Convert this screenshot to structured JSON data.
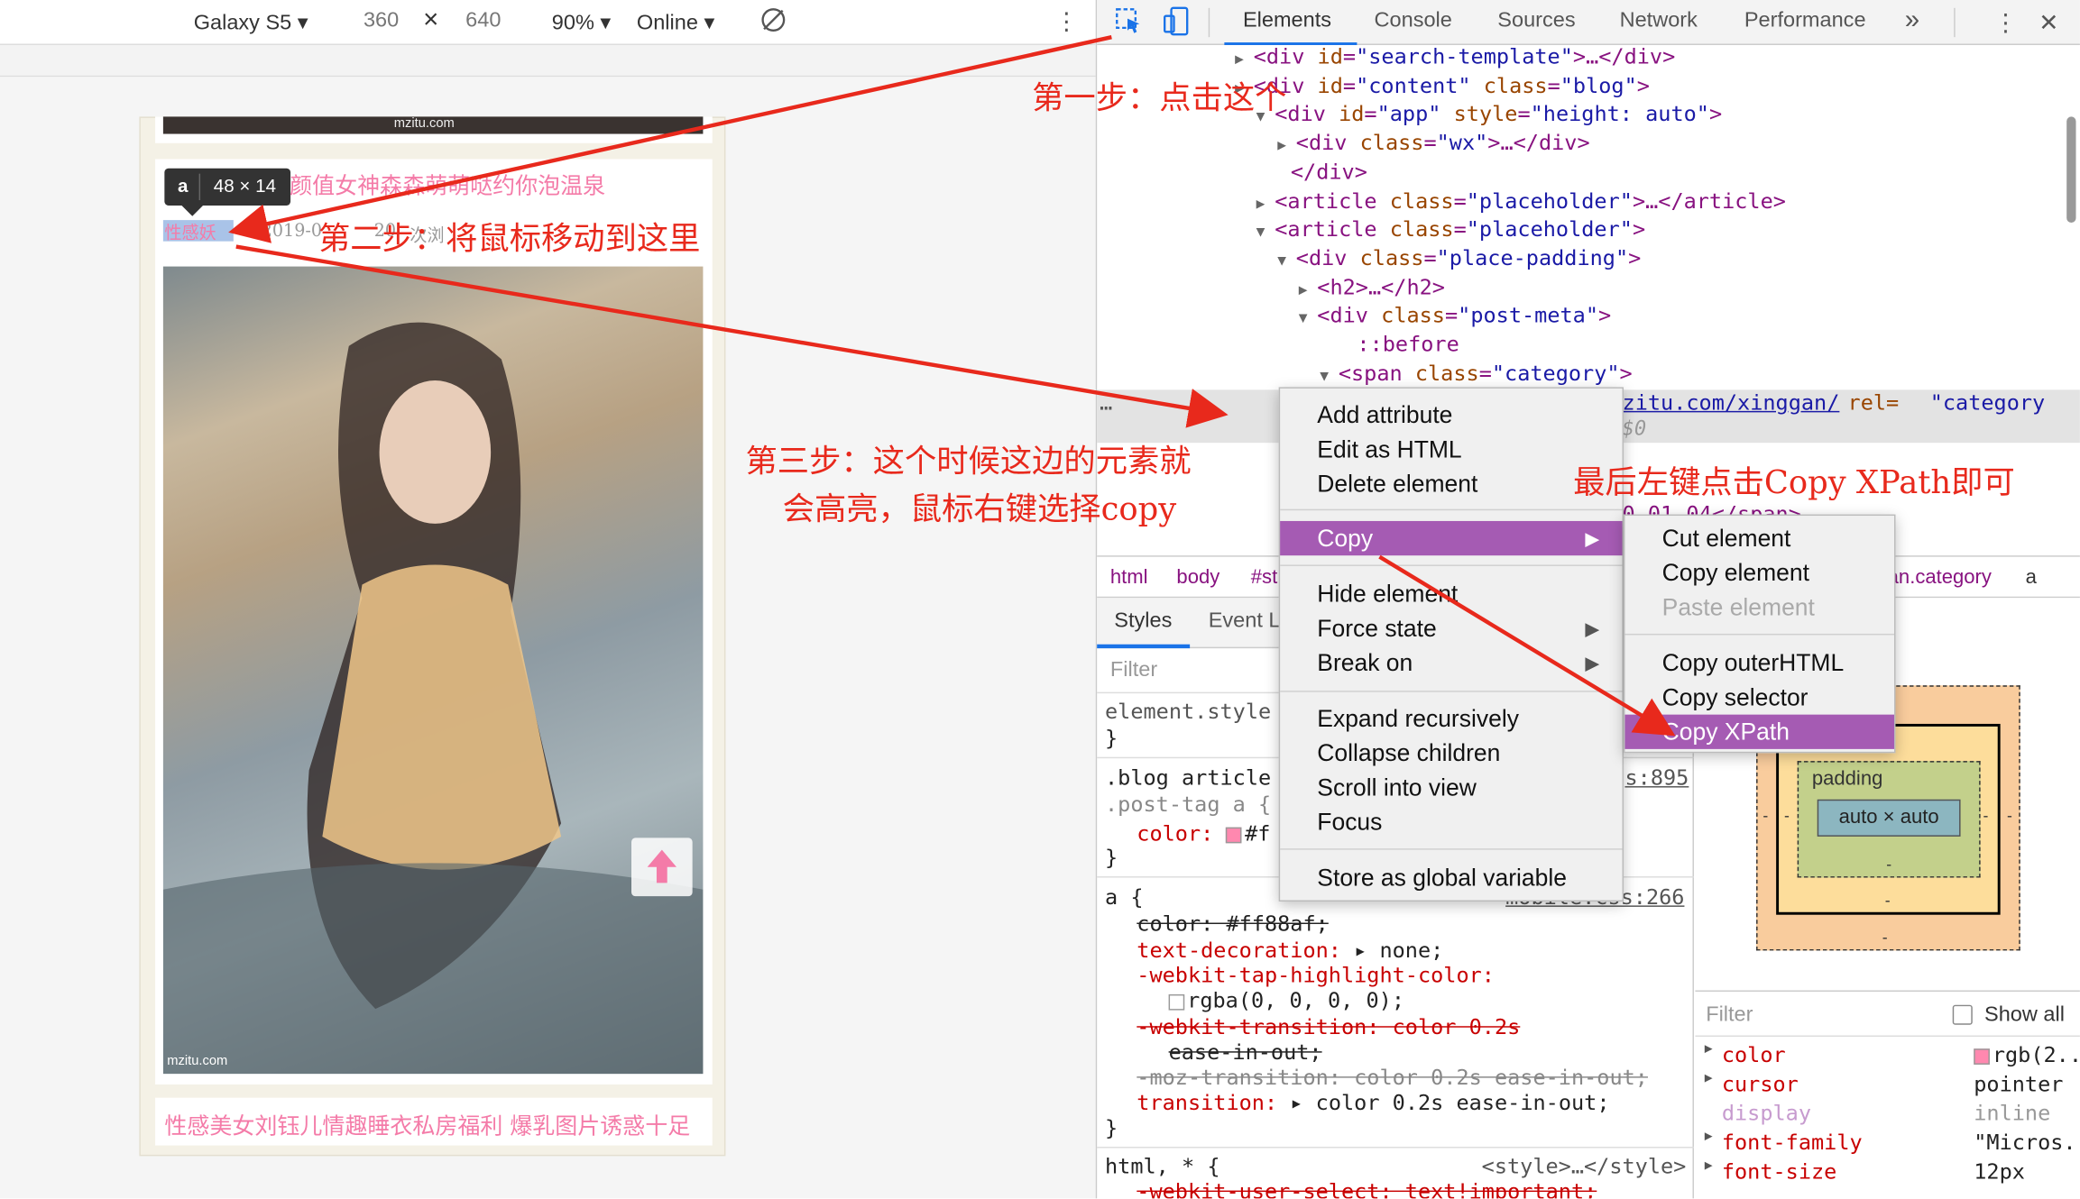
{
  "device_toolbar": {
    "device": "Galaxy S5",
    "width": "360",
    "times": "×",
    "height": "640",
    "zoom": "90%",
    "network": "Online"
  },
  "page": {
    "watermark": "mzitu.com",
    "post_title": "性感 颜值女神森森萌萌哒约你泡温泉",
    "post_category": "性感妖",
    "post_date": "2019-0",
    "post_extra": "20",
    "views": "次浏",
    "tooltip_tag": "a",
    "tooltip_size": "48 × 14",
    "photo_watermark": "mzitu.com",
    "next_title": "性感美女刘钰儿情趣睡衣私房福利 爆乳图片诱惑十足"
  },
  "devtools": {
    "tabs": [
      "Elements",
      "Console",
      "Sources",
      "Network",
      "Performance"
    ],
    "more": "»",
    "dom_lines": [
      {
        "pre": "▶",
        "html": "<div id=\"search-template\">…</div>"
      },
      {
        "pre": "▶",
        "html": "<div id=\"content\" class=\"blog\">"
      },
      {
        "pre": "▼",
        "html": "<div id=\"app\" style=\"height: auto\">"
      },
      {
        "pre": "▶",
        "html": "<div class=\"wx\">…</div>"
      },
      {
        "pre": "",
        "html": "</div>"
      },
      {
        "pre": "▶",
        "html": "<article class=\"placeholder\">…</article>"
      },
      {
        "pre": "▼",
        "html": "<article class=\"placeholder\">"
      },
      {
        "pre": "▼",
        "html": "<div class=\"place-padding\">"
      },
      {
        "pre": "▶",
        "html": "<h2>…</h2>"
      },
      {
        "pre": "▼",
        "html": "<div class=\"post-meta\">"
      },
      {
        "pre": "",
        "html": "::before"
      },
      {
        "pre": "▼",
        "html": "<span class=\"category\">"
      }
    ],
    "selected_line": {
      "ellipsis": "…",
      "link": "zitu.com/xinggan/",
      "attr": " rel=",
      "value": "\"category",
      "hint": "$0"
    },
    "partial_line": "0 01 04</span>",
    "breadcrumbs": [
      "html",
      "body",
      "#st",
      "an.category",
      "a"
    ],
    "style_tabs": [
      "Styles",
      "Event L"
    ],
    "filter_placeholder": "Filter",
    "styles": {
      "element_style": "element.style {",
      "close1": "}",
      "rule1_sel1": ".blog article",
      "rule1_sel2": ".post-tag a {",
      "rule1_src": "s:895",
      "rule1_prop": "color:",
      "rule1_val": "#f",
      "close2": "}",
      "rule2_sel": "a {",
      "rule2_src": "mobile.css:266",
      "r2_color": "color: #ff88af;",
      "r2_td_prop": "text-decoration:",
      "r2_td_val": "none;",
      "r2_tap_prop": "-webkit-tap-highlight-color:",
      "r2_tap_val": "rgba(0, 0, 0, 0);",
      "r2_wt": "-webkit-transition: color 0.2s",
      "r2_ease1": "ease-in-out;",
      "r2_moz": "-moz-transition: color 0.2s ease-in-out;",
      "r2_tr_prop": "transition:",
      "r2_tr_val": "color 0.2s",
      "r2_ease2": "ease-in-out;",
      "close3": "}",
      "rule3_sel": "html, * {",
      "rule3_src": "<style>…</style>",
      "r3_line": "-webkit-user-select: text!important;"
    },
    "boxmodel": {
      "padding": "padding",
      "content": "auto × auto",
      "dash": "-"
    },
    "computed": {
      "filter_placeholder": "Filter",
      "show_all": "Show all",
      "rows": [
        {
          "name": "color",
          "value": "rgb(2..."
        },
        {
          "name": "cursor",
          "value": "pointer"
        },
        {
          "name": "display",
          "value": "inline"
        },
        {
          "name": "font-family",
          "value": "\"Micros..."
        },
        {
          "name": "font-size",
          "value": "12px"
        }
      ]
    }
  },
  "context_menu": {
    "items": [
      "Add attribute",
      "Edit as HTML",
      "Delete element",
      "Copy",
      "Hide element",
      "Force state",
      "Break on",
      "Expand recursively",
      "Collapse children",
      "Scroll into view",
      "Focus",
      "Store as global variable"
    ],
    "submenu": [
      "Cut element",
      "Copy element",
      "Paste element",
      "Copy outerHTML",
      "Copy selector",
      "Copy XPath"
    ]
  },
  "annotations": {
    "step1": "第一步：点击这个",
    "step2": "第二步：将鼠标移动到这里",
    "step3_line1": "第三步：这个时候这边的元素就",
    "step3_line2": "会高亮，鼠标右键选择copy",
    "final": "最后左键点击Copy XPath即可"
  },
  "colors": {
    "annotation": "#e8291c",
    "menu_highlight": "#a55bb3",
    "title_pink": "#f47ba8"
  }
}
